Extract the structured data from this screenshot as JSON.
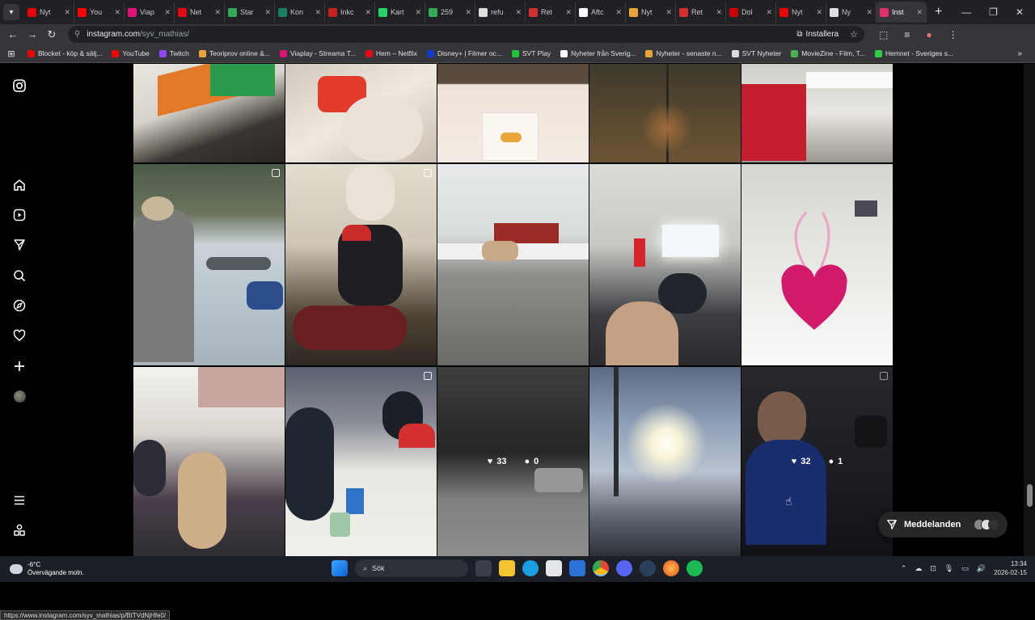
{
  "browser": {
    "tabs": [
      {
        "title": "Nyt",
        "color": "#e00"
      },
      {
        "title": "You",
        "color": "#f00"
      },
      {
        "title": "Viap",
        "color": "#e0127a"
      },
      {
        "title": "Net",
        "color": "#e50914"
      },
      {
        "title": "Star",
        "color": "#34a853"
      },
      {
        "title": "Kon",
        "color": "#1a7f64"
      },
      {
        "title": "Inkc",
        "color": "#c5221f"
      },
      {
        "title": "Kart",
        "color": "#25d366"
      },
      {
        "title": "259",
        "color": "#34a853"
      },
      {
        "title": "refu",
        "color": "#ddd"
      },
      {
        "title": "Ret",
        "color": "#d32f2f"
      },
      {
        "title": "Aftc",
        "color": "#fff"
      },
      {
        "title": "Nyt",
        "color": "#e9a43a"
      },
      {
        "title": "Ret",
        "color": "#d32f2f"
      },
      {
        "title": "Dol",
        "color": "#c00"
      },
      {
        "title": "Nyt",
        "color": "#e00"
      },
      {
        "title": "Ny",
        "color": "#ddd"
      },
      {
        "title": "Inst",
        "color": "#e1306c"
      }
    ],
    "active_tab_index": 17,
    "url_site": "instagram.com",
    "url_path": "/syv_mathias/",
    "install_label": "Installera",
    "bookmarks": [
      {
        "label": "Blocket - köp & sälj...",
        "color": "#e00"
      },
      {
        "label": "YouTube",
        "color": "#f00"
      },
      {
        "label": "Twitch",
        "color": "#9146ff"
      },
      {
        "label": "Teoriprov online &...",
        "color": "#e9a43a"
      },
      {
        "label": "Viaplay - Streama T...",
        "color": "#e0127a"
      },
      {
        "label": "Hem – Netflix",
        "color": "#e50914"
      },
      {
        "label": "Disney+ | Filmer oc...",
        "color": "#113ccf"
      },
      {
        "label": "SVT Play",
        "color": "#24c13a"
      },
      {
        "label": "Nyheter från Sverig...",
        "color": "#fff"
      },
      {
        "label": "Nyheter - senaste n...",
        "color": "#e9a43a"
      },
      {
        "label": "SVT Nyheter",
        "color": "#ddd"
      },
      {
        "label": "MovieZine - Film, T...",
        "color": "#4caf50"
      },
      {
        "label": "Hemnet - Sveriges s...",
        "color": "#2ecc40"
      }
    ],
    "status_url": "https://www.instagram.com/syv_mathias/p/BtTVdNjHfe0/"
  },
  "instagram": {
    "nav_icons": [
      "instagram-logo-icon",
      "home-icon",
      "reels-icon",
      "direct-icon",
      "search-icon",
      "explore-icon",
      "heart-icon",
      "create-icon",
      "profile-avatar",
      "menu-icon",
      "more-apps-icon"
    ],
    "posts_row3": [
      {
        "likes": "33",
        "comments": "0"
      },
      {
        "likes": "32",
        "comments": "1"
      }
    ],
    "messages_label": "Meddelanden"
  },
  "taskbar": {
    "temp": "-6°C",
    "weather": "Övervägande moln.",
    "search_label": "Sök",
    "time": "13:34",
    "date": "2026-02-15"
  }
}
